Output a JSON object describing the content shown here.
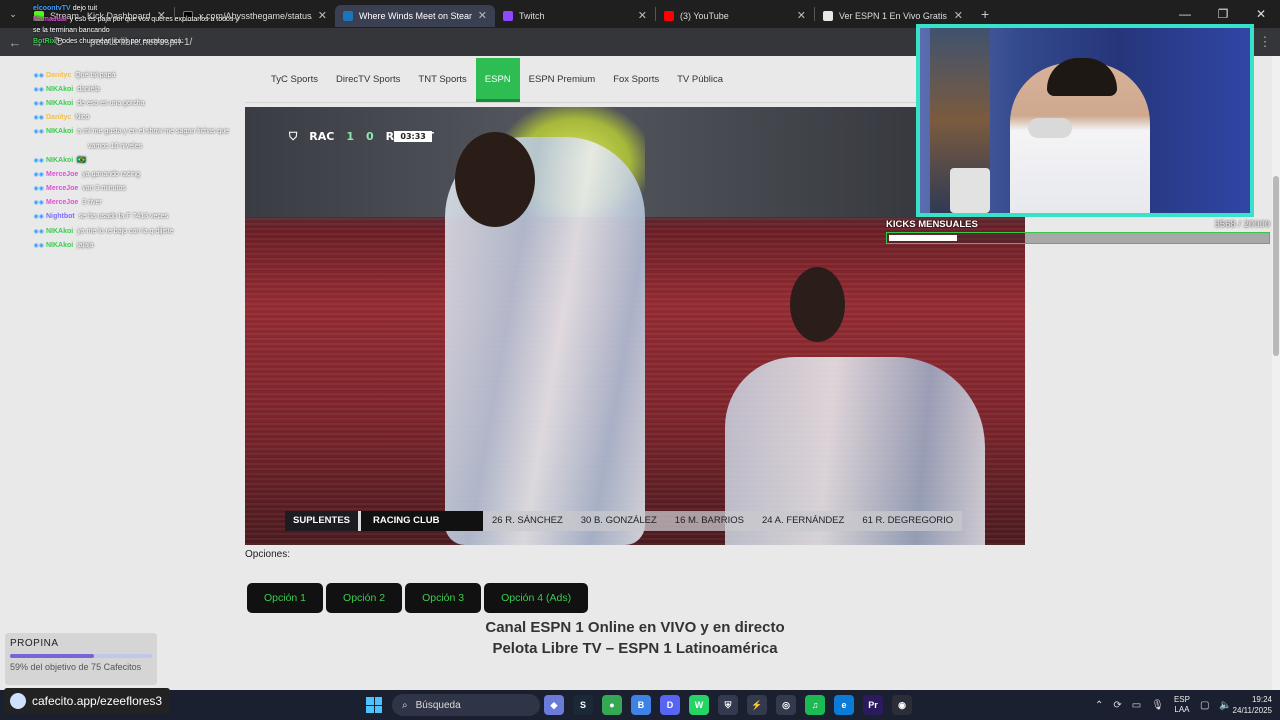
{
  "browser": {
    "tabs": [
      {
        "title": "Stream - Kick Dashboard",
        "fav_color": "#53fc18",
        "active": false
      },
      {
        "title": "x.com/Abyssthegame/status/19",
        "fav_color": "#000000",
        "active": false
      },
      {
        "title": "Where Winds Meet on Steam",
        "fav_color": "#1b75bb",
        "active": true
      },
      {
        "title": "Twitch",
        "fav_color": "#9146ff",
        "active": false
      },
      {
        "title": "(3) YouTube",
        "fav_color": "#ff0000",
        "active": false
      },
      {
        "title": "Ver ESPN 1 En Vivo Gratis - Pel",
        "fav_color": "#e8e8e8",
        "active": false
      }
    ],
    "url": "pelota-libre.net/espn-1/"
  },
  "site": {
    "nav": [
      "TyC Sports",
      "DirecTV Sports",
      "TNT Sports",
      "ESPN",
      "ESPN Premium",
      "Fox Sports",
      "TV Pública"
    ],
    "active_nav": "ESPN",
    "scorebug": {
      "home": "RAC",
      "home_score": "1",
      "away_score": "0",
      "away": "RIV",
      "period": "1T",
      "clock": "03:33"
    },
    "lineup": {
      "label": "SUPLENTES",
      "club": "RACING CLUB",
      "players": [
        "26 R. SÁNCHEZ",
        "30 B. GONZÁLEZ",
        "16 M. BARRIOS",
        "24 A. FERNÁNDEZ",
        "61 R. DEGREGORIO"
      ]
    },
    "options_label": "Opciones:",
    "options": [
      "Opción 1",
      "Opción 2",
      "Opción 3",
      "Opción 4 (Ads)"
    ],
    "heading_line1": "Canal ESPN 1 Online en VIVO y en directo",
    "heading_line2": "Pelota Libre TV – ESPN 1 Latinoamérica"
  },
  "overlay": {
    "top_chat": [
      {
        "user": "elcoontvTV",
        "text": "dejo tuit"
      },
      {
        "user": "MamaJuar",
        "text": "y eso es paja por que vos queres explotarlos a todos y se la terminan bancando"
      },
      {
        "user": "BotRix",
        "text": "Podes chusmear libros por encargo acá:"
      }
    ],
    "chat": [
      {
        "user": "Danityc",
        "color": "#f2c14e",
        "text": "Qué tal papá"
      },
      {
        "user": "NIKAkoi",
        "color": "#3ccb4f",
        "text": "daniela"
      },
      {
        "user": "NIKAkoi",
        "color": "#3ccb4f",
        "text": "de eso es una gorcha"
      },
      {
        "user": "Danityc",
        "color": "#f2c14e",
        "text": "Nico"
      },
      {
        "user": "NIKAkoi",
        "color": "#3ccb4f",
        "text": "a mí me gusta y en el show me sagan fichas que"
      },
      {
        "user": "",
        "color": "#3ccb4f",
        "text": "vamos 10 niveles"
      },
      {
        "user": "NIKAkoi",
        "color": "#3ccb4f",
        "text": "🇧🇷"
      },
      {
        "user": "MerceJoe",
        "color": "#e04fd8",
        "text": "ya ganando racing"
      },
      {
        "user": "MerceJoe",
        "color": "#e04fd8",
        "text": "van 3 minutos"
      },
      {
        "user": "MerceJoe",
        "color": "#e04fd8",
        "text": "3 river"
      },
      {
        "user": "Nightbot",
        "color": "#7a6cff",
        "text": "se ha usado la F 7413 veces"
      },
      {
        "user": "NIKAkoi",
        "color": "#3ccb4f",
        "text": "ya me lo re bajo con la q dijiste"
      },
      {
        "user": "NIKAkoi",
        "color": "#3ccb4f",
        "text": "jajaja"
      }
    ],
    "kicks_label": "KICKS MENSUALES",
    "kicks_count": "3568 / 20000",
    "kicks_fraction": 0.178,
    "tip_title": "PROPINA",
    "tip_text": "59% del objetivo de 75 Cafecitos",
    "tip_fraction": 0.59,
    "cafecito": "cafecito.app/ezeeflores3"
  },
  "taskbar": {
    "search": "Búsqueda",
    "lang1": "ESP",
    "lang2": "LAA",
    "time": "19:24",
    "date": "24/11/2025",
    "apps": [
      {
        "icon": "copilot-icon",
        "color": "#6a7bd8",
        "label": "◆"
      },
      {
        "icon": "steam-icon",
        "color": "#1b2838",
        "label": "S"
      },
      {
        "icon": "chrome-icon",
        "color": "#34a853",
        "label": "●"
      },
      {
        "icon": "betterdiscord-icon",
        "color": "#3e82e5",
        "label": "B"
      },
      {
        "icon": "discord-icon",
        "color": "#5865f2",
        "label": "D"
      },
      {
        "icon": "whatsapp-icon",
        "color": "#25d366",
        "label": "W"
      },
      {
        "icon": "shield-icon",
        "color": "#333a4d",
        "label": "⛨"
      },
      {
        "icon": "bolt-icon",
        "color": "#333a4d",
        "label": "⚡"
      },
      {
        "icon": "globe-icon",
        "color": "#333a4d",
        "label": "◎"
      },
      {
        "icon": "spotify-icon",
        "color": "#1db954",
        "label": "♫"
      },
      {
        "icon": "edge-icon",
        "color": "#0c7bd6",
        "label": "e"
      },
      {
        "icon": "premiere-icon",
        "color": "#2a1a5e",
        "label": "Pr"
      },
      {
        "icon": "obs-icon",
        "color": "#2b2e38",
        "label": "◉"
      }
    ]
  }
}
